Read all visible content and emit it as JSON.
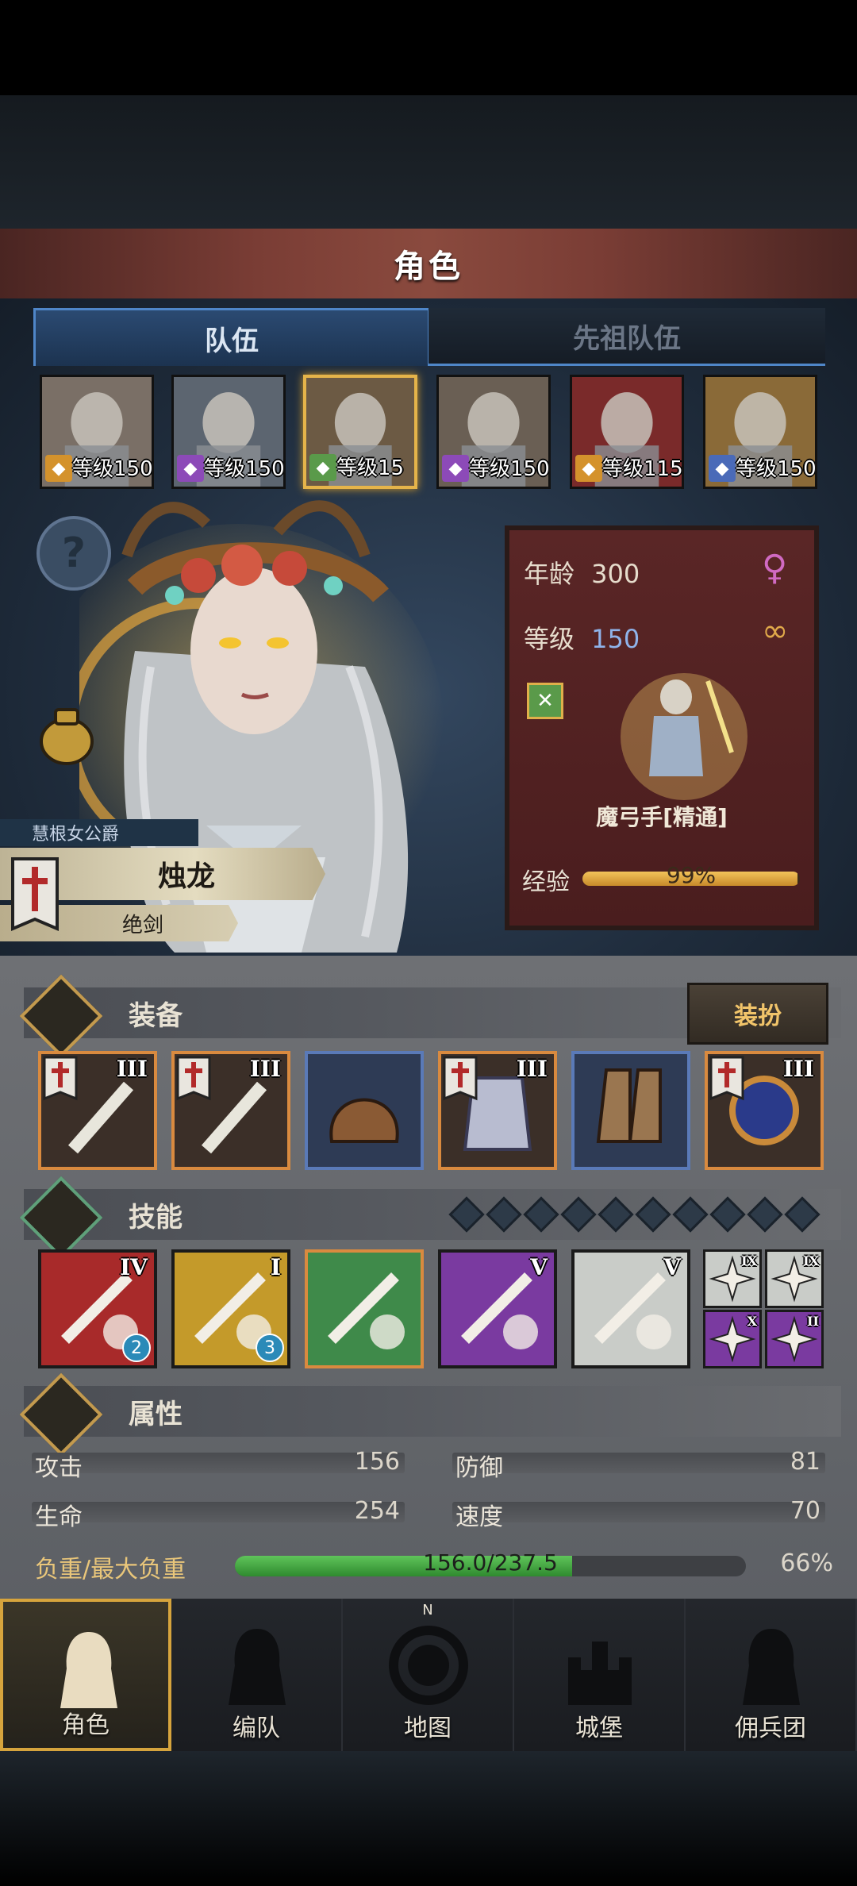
{
  "title": "角色",
  "tabs": [
    {
      "label": "队伍",
      "active": true
    },
    {
      "label": "先祖队伍",
      "active": false
    }
  ],
  "heroes": [
    {
      "level": "等级150",
      "class_icon": "shield-icon",
      "class_color": "#d4922c",
      "selected": false
    },
    {
      "level": "等级150",
      "class_icon": "staff-icon",
      "class_color": "#8c4ab8",
      "selected": false
    },
    {
      "level": "等级15",
      "class_icon": "bow-icon",
      "class_color": "#5a9a4a",
      "selected": true
    },
    {
      "level": "等级150",
      "class_icon": "staff-icon",
      "class_color": "#8c4ab8",
      "selected": false
    },
    {
      "level": "等级115",
      "class_icon": "shield-icon",
      "class_color": "#d4922c",
      "selected": false
    },
    {
      "level": "等级150",
      "class_icon": "sword-icon",
      "class_color": "#4a6ab8",
      "selected": false
    }
  ],
  "character": {
    "title": "慧根女公爵",
    "name": "烛龙",
    "subtitle": "绝剑",
    "age_label": "年龄",
    "age": "300",
    "level_label": "等级",
    "level": "150",
    "class_name": "魔弓手[精通]",
    "exp_label": "经验",
    "exp_percent": "99%",
    "exp_fraction": 0.99
  },
  "equipment": {
    "section_label": "装备",
    "dress_button": "装扮",
    "slots": [
      {
        "icon": "sword-icon",
        "tier": "III",
        "frame": "orange"
      },
      {
        "icon": "sword-icon",
        "tier": "III",
        "frame": "orange"
      },
      {
        "icon": "helmet-icon",
        "tier": "",
        "frame": "blue"
      },
      {
        "icon": "armor-icon",
        "tier": "III",
        "frame": "orange"
      },
      {
        "icon": "boots-icon",
        "tier": "",
        "frame": "blue"
      },
      {
        "icon": "orb-icon",
        "tier": "III",
        "frame": "orange"
      }
    ]
  },
  "skills": {
    "section_label": "技能",
    "diamond_count": 10,
    "large": [
      {
        "icon": "sword-strike-icon",
        "tier": "IV",
        "badge": "2",
        "color": "#a82a2a"
      },
      {
        "icon": "holy-shield-icon",
        "tier": "I",
        "badge": "3",
        "color": "#c49a2a"
      },
      {
        "icon": "crystal-staff-icon",
        "tier": "",
        "badge": "",
        "color": "#3f8a4a"
      },
      {
        "icon": "crystal-arm-icon",
        "tier": "V",
        "badge": "",
        "color": "#7a3aa0"
      },
      {
        "icon": "crystal-arm-icon",
        "tier": "V",
        "badge": "",
        "color": "#c9ccc8"
      }
    ],
    "small": [
      {
        "icon": "burst-icon",
        "tier": "IX",
        "color": "#c9ccc8"
      },
      {
        "icon": "burst-icon",
        "tier": "IX",
        "color": "#c9ccc8"
      },
      {
        "icon": "burst-icon",
        "tier": "X",
        "color": "#7a3aa0"
      },
      {
        "icon": "wand-icon",
        "tier": "II",
        "color": "#7a3aa0"
      }
    ]
  },
  "attributes": {
    "section_label": "属性",
    "attack_label": "攻击",
    "attack": "156",
    "defense_label": "防御",
    "defense": "81",
    "hp_label": "生命",
    "hp": "254",
    "speed_label": "速度",
    "speed": "70",
    "load_label": "负重/最大负重",
    "load_value": "156.0/237.5",
    "load_percent": "66%",
    "load_fraction": 0.66
  },
  "nav": [
    {
      "label": "角色",
      "icon": "knight-icon",
      "active": true
    },
    {
      "label": "编队",
      "icon": "helmet-icon",
      "active": false
    },
    {
      "label": "地图",
      "icon": "compass-icon",
      "active": false
    },
    {
      "label": "城堡",
      "icon": "castle-icon",
      "active": false
    },
    {
      "label": "佣兵团",
      "icon": "banner-icon",
      "active": false
    }
  ],
  "compass_letter": "N"
}
